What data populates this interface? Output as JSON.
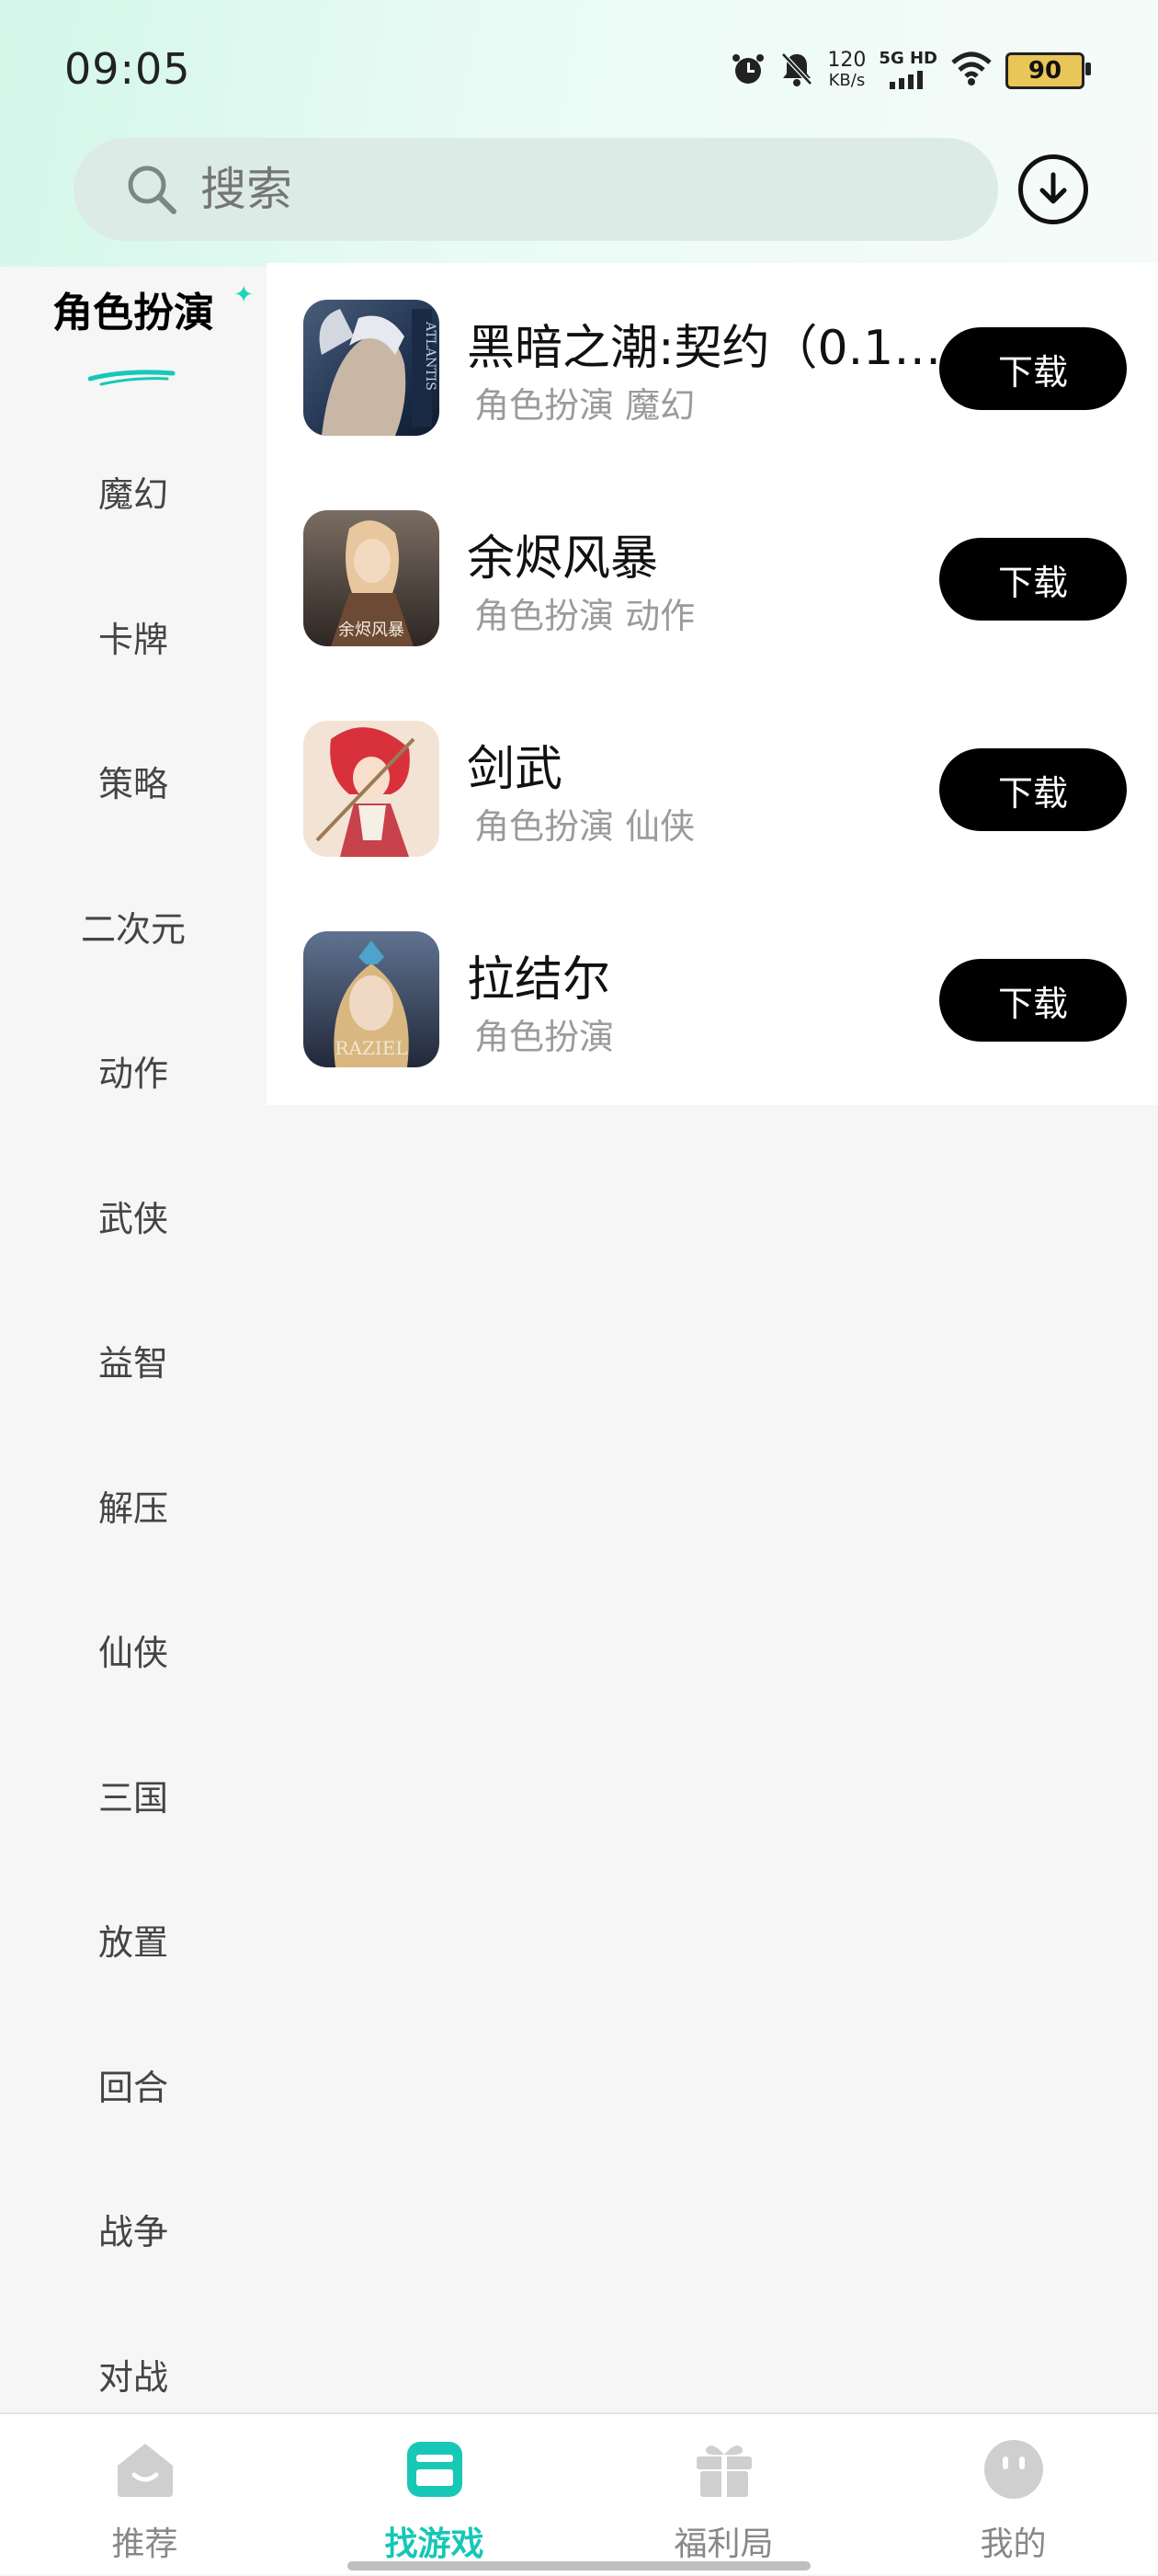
{
  "status_bar": {
    "time": "09:05",
    "speed_value": "120",
    "speed_unit": "KB/s",
    "network_line1": "5G HD",
    "battery": "90"
  },
  "search": {
    "placeholder": "搜索"
  },
  "sidebar": {
    "active": "角色扮演",
    "items": [
      "魔幻",
      "卡牌",
      "策略",
      "二次元",
      "动作",
      "武侠",
      "益智",
      "解压",
      "仙侠",
      "三国",
      "放置",
      "回合",
      "战争",
      "对战"
    ]
  },
  "games": [
    {
      "name": "黑暗之潮:契约（0.1…",
      "tags": "角色扮演 魔幻",
      "button": "下载",
      "icon": "atlantis-game-icon"
    },
    {
      "name": "余烬风暴",
      "tags": "角色扮演 动作",
      "button": "下载",
      "icon": "ember-storm-game-icon"
    },
    {
      "name": "剑武",
      "tags": "角色扮演 仙侠",
      "button": "下载",
      "icon": "sword-martial-game-icon"
    },
    {
      "name": "拉结尔",
      "tags": "角色扮演",
      "button": "下载",
      "icon": "raziel-game-icon"
    }
  ],
  "bottom_nav": [
    {
      "label": "推荐",
      "icon": "recommend-icon"
    },
    {
      "label": "找游戏",
      "icon": "find-games-icon",
      "active": true
    },
    {
      "label": "福利局",
      "icon": "gift-icon"
    },
    {
      "label": "我的",
      "icon": "profile-icon"
    }
  ],
  "colors": {
    "accent": "#16c7b7",
    "button": "#000000"
  }
}
